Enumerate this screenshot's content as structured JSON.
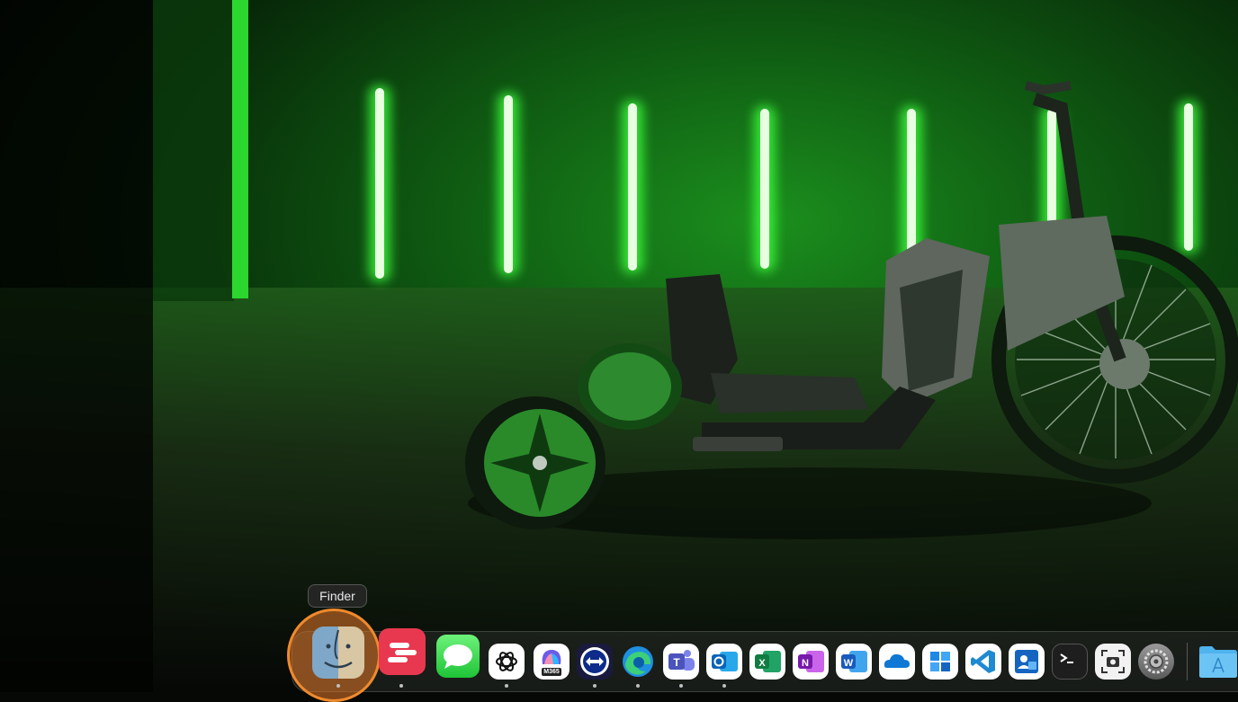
{
  "tooltip": {
    "text": "Finder"
  },
  "dock": {
    "items": [
      {
        "name": "Finder",
        "icon": "finder-icon",
        "running": true
      },
      {
        "name": "Toolbox",
        "icon": "toolbox-icon",
        "running": true
      },
      {
        "name": "Messages",
        "icon": "messages-icon",
        "running": false
      },
      {
        "name": "ChatGPT",
        "icon": "chatgpt-icon",
        "running": true
      },
      {
        "name": "Microsoft 365 Copilot",
        "icon": "copilot-m365-icon",
        "badge": "M365",
        "running": false
      },
      {
        "name": "TeamViewer",
        "icon": "teamviewer-icon",
        "running": true
      },
      {
        "name": "Microsoft Edge",
        "icon": "edge-icon",
        "running": true
      },
      {
        "name": "Microsoft Teams",
        "icon": "teams-icon",
        "running": true
      },
      {
        "name": "Microsoft Outlook",
        "icon": "outlook-icon",
        "running": true
      },
      {
        "name": "Microsoft Excel",
        "icon": "excel-icon",
        "running": false
      },
      {
        "name": "Microsoft OneNote",
        "icon": "onenote-icon",
        "running": false
      },
      {
        "name": "Microsoft Word",
        "icon": "word-icon",
        "running": false
      },
      {
        "name": "OneDrive",
        "icon": "onedrive-icon",
        "running": false
      },
      {
        "name": "Windows App",
        "icon": "windows-app-icon",
        "running": false
      },
      {
        "name": "Visual Studio Code",
        "icon": "vscode-icon",
        "running": false
      },
      {
        "name": "Company Portal",
        "icon": "company-portal-icon",
        "running": false
      },
      {
        "name": "Terminal",
        "icon": "terminal-icon",
        "running": false
      },
      {
        "name": "Screenshot",
        "icon": "screenshot-icon",
        "running": false
      },
      {
        "name": "System Settings",
        "icon": "system-settings-icon",
        "running": false
      },
      {
        "name": "Applications",
        "icon": "applications-folder-icon",
        "running": false
      }
    ]
  },
  "colors": {
    "neon": "#39ff3a",
    "highlight_ring": "#f08a2c"
  }
}
